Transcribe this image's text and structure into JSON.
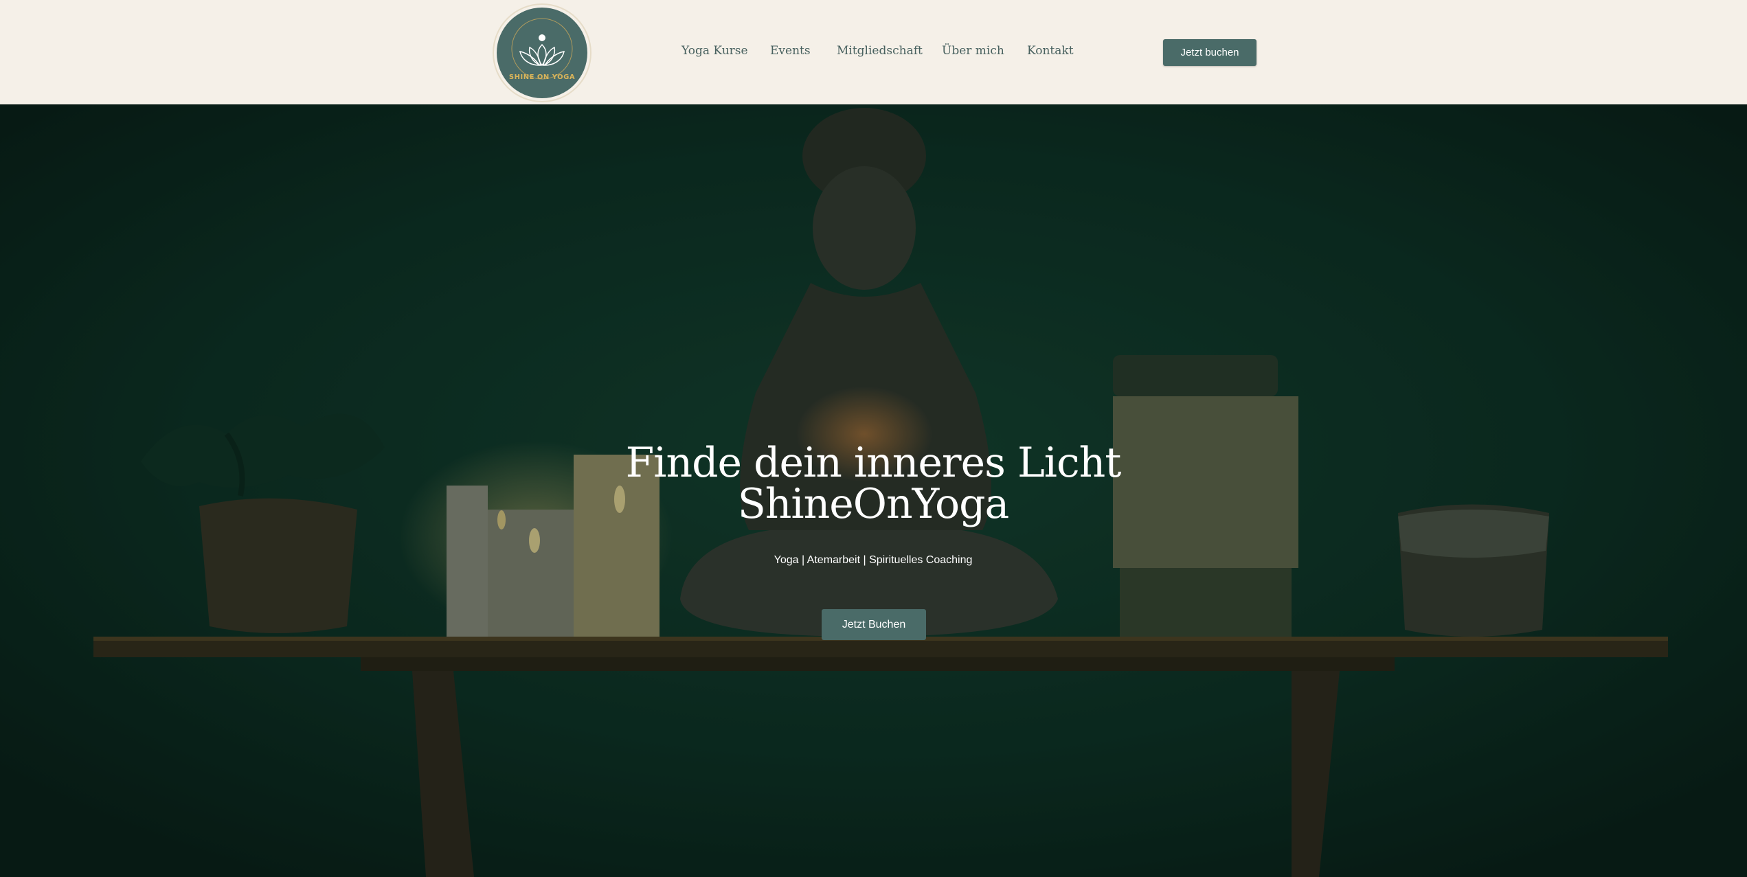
{
  "brand": {
    "name": "ShineOnYoga",
    "logo_text": "SHINE ON YOGA"
  },
  "nav": {
    "items": [
      {
        "label": "Yoga Kurse"
      },
      {
        "label": "Events"
      },
      {
        "label": "Mitgliedschaft"
      },
      {
        "label": "Über mich"
      },
      {
        "label": "Kontakt"
      }
    ],
    "cta_label": "Jetzt buchen"
  },
  "hero": {
    "title_line1": "Finde dein inneres Licht",
    "title_line2": "ShineOnYoga",
    "subtitle": "Yoga | Atemarbeit | Spirituelles Coaching",
    "cta_label": "Jetzt Buchen"
  },
  "colors": {
    "header_bg": "#f5f0e8",
    "accent": "#4a6b68",
    "nav_text": "#48615f",
    "logo_gold": "#d9b45a",
    "hero_bg": "#0d2a20"
  }
}
